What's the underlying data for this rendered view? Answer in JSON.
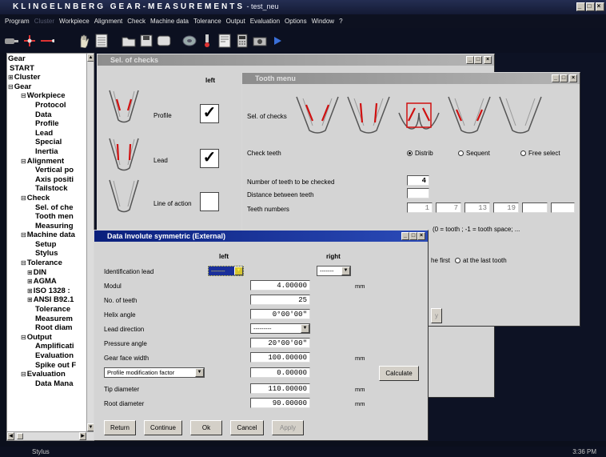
{
  "app": {
    "title": "KLINGELNBERG GEAR-MEASUREMENTS",
    "subtitle": " - test_neu",
    "window_buttons": [
      "_",
      "□",
      "×"
    ]
  },
  "menu": [
    "Program",
    "Cluster",
    "Workpiece",
    "Alignment",
    "Check",
    "Machine data",
    "Tolerance",
    "Output",
    "Evaluation",
    "Options",
    "Window",
    "?"
  ],
  "tree": [
    {
      "label": "Gear",
      "level": 0,
      "toggle": ""
    },
    {
      "label": "START",
      "level": 1,
      "toggle": ""
    },
    {
      "label": "Cluster",
      "level": 0,
      "toggle": "+"
    },
    {
      "label": "Gear",
      "level": 0,
      "toggle": "−"
    },
    {
      "label": "Workpiece",
      "level": 2,
      "toggle": "−"
    },
    {
      "label": "Protocol",
      "level": 3,
      "toggle": ""
    },
    {
      "label": "Data",
      "level": 3,
      "toggle": ""
    },
    {
      "label": "Profile",
      "level": 3,
      "toggle": ""
    },
    {
      "label": "Lead",
      "level": 3,
      "toggle": ""
    },
    {
      "label": "Special",
      "level": 3,
      "toggle": ""
    },
    {
      "label": "Inertia",
      "level": 3,
      "toggle": ""
    },
    {
      "label": "Alignment",
      "level": 2,
      "toggle": "−"
    },
    {
      "label": "Vertical po",
      "level": 3,
      "toggle": ""
    },
    {
      "label": "Axis positi",
      "level": 3,
      "toggle": ""
    },
    {
      "label": "Tailstock",
      "level": 3,
      "toggle": ""
    },
    {
      "label": "Check",
      "level": 2,
      "toggle": "−"
    },
    {
      "label": "Sel. of che",
      "level": 3,
      "toggle": ""
    },
    {
      "label": "Tooth men",
      "level": 3,
      "toggle": ""
    },
    {
      "label": "Measuring",
      "level": 3,
      "toggle": ""
    },
    {
      "label": "Machine data",
      "level": 2,
      "toggle": "−"
    },
    {
      "label": "Setup",
      "level": 3,
      "toggle": ""
    },
    {
      "label": "Stylus",
      "level": 3,
      "toggle": ""
    },
    {
      "label": "Tolerance",
      "level": 2,
      "toggle": "−"
    },
    {
      "label": "DIN",
      "level": 2.5,
      "toggle": "+"
    },
    {
      "label": "AGMA",
      "level": 2.5,
      "toggle": "+"
    },
    {
      "label": "ISO 1328 :",
      "level": 2.5,
      "toggle": "+"
    },
    {
      "label": "ANSI B92.1",
      "level": 2.5,
      "toggle": "+"
    },
    {
      "label": "Tolerance",
      "level": 3,
      "toggle": ""
    },
    {
      "label": "Measurem",
      "level": 3,
      "toggle": ""
    },
    {
      "label": "Root diam",
      "level": 3,
      "toggle": ""
    },
    {
      "label": "Output",
      "level": 2,
      "toggle": "−"
    },
    {
      "label": "Amplificati",
      "level": 3,
      "toggle": ""
    },
    {
      "label": "Evaluation",
      "level": 3,
      "toggle": ""
    },
    {
      "label": "Spike out F",
      "level": 3,
      "toggle": ""
    },
    {
      "label": "Evaluation",
      "level": 2,
      "toggle": "−"
    },
    {
      "label": "Data Mana",
      "level": 3,
      "toggle": ""
    }
  ],
  "sel_of_checks": {
    "title": "Sel. of checks",
    "column_label": "left",
    "rows": [
      {
        "label": "Profile",
        "checked": "✓"
      },
      {
        "label": "Lead",
        "checked": "✓"
      },
      {
        "label": "Line of action",
        "checked": ""
      }
    ]
  },
  "tooth_menu": {
    "title": "Tooth menu",
    "sel_of_checks_label": "Sel. of checks",
    "check_teeth_label": "Check teeth",
    "check_teeth_options": [
      "Distrib",
      "Sequent",
      "Free select"
    ],
    "num_teeth_label": "Number of teeth to be checked",
    "num_teeth_value": "4",
    "distance_label": "Distance between teeth",
    "distance_value": "",
    "teeth_numbers_label": "Teeth numbers",
    "teeth_numbers": [
      "1",
      "7",
      "13",
      "19",
      "",
      ""
    ],
    "tooth_space_note": "(0 = tooth ; -1 = tooth space; ...",
    "first_option": "he first",
    "last_option": "at the last tooth",
    "apply_fragment": "y"
  },
  "involute": {
    "title": "Data Involute symmetric (External)",
    "col_left": "left",
    "col_right": "right",
    "identification_label": "Identification lead",
    "identification_left": "-------",
    "identification_right": "-------",
    "rows": [
      {
        "label": "Modul",
        "value": "4.00000",
        "unit": "mm"
      },
      {
        "label": "No. of teeth",
        "value": "25",
        "unit": ""
      },
      {
        "label": "Helix angle",
        "value": "0°00'00\"",
        "unit": ""
      },
      {
        "label": "Lead direction",
        "value": "---------",
        "unit": ""
      },
      {
        "label": "Pressure angle",
        "value": "20°00'00\"",
        "unit": ""
      },
      {
        "label": "Gear face width",
        "value": "100.00000",
        "unit": "mm"
      },
      {
        "label": "Profile modification factor",
        "value": "0.00000",
        "unit": ""
      },
      {
        "label": "Tip diameter",
        "value": "110.00000",
        "unit": "mm"
      },
      {
        "label": "Root diameter",
        "value": "90.00000",
        "unit": "mm"
      }
    ],
    "calculate_label": "Calculate",
    "buttons": [
      "Return",
      "Continue",
      "Ok",
      "Cancel",
      "Apply"
    ]
  },
  "status": {
    "left": "Stylus",
    "time": "3:36 PM"
  },
  "colors": {
    "active_title": "#0a1f7c",
    "profile_red": "#d01010",
    "background": "#0b0f1c"
  }
}
